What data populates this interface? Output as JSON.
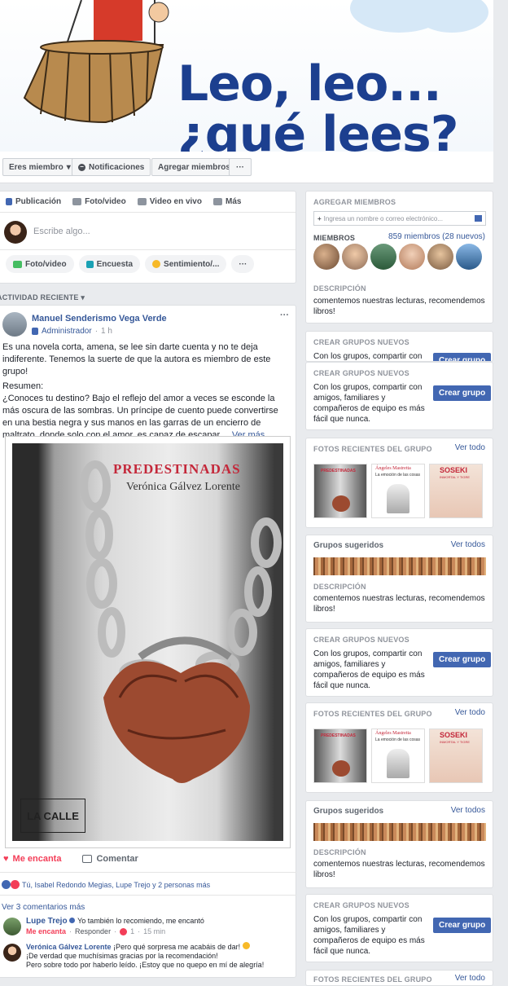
{
  "cover": {
    "title_line1": "Leo, leo...",
    "title_line2": "¿qué lees?"
  },
  "actions": {
    "member": "Eres miembro",
    "notifications": "Notificaciones",
    "add_members": "Agregar miembros",
    "more": "···"
  },
  "composer": {
    "tabs": [
      "Publicación",
      "Foto/video",
      "Video en vivo",
      "Más"
    ],
    "placeholder": "Escribe algo...",
    "pills": [
      "Foto/video",
      "Encuesta",
      "Sentimiento/...",
      "···"
    ]
  },
  "activity": {
    "label": "ACTIVIDAD RECIENTE"
  },
  "post": {
    "author": "Manuel Senderismo Vega Verde",
    "role": "Administrador",
    "time": "1 h",
    "menu": "···",
    "paragraph1": "Es una novela corta, amena, se lee sin darte cuenta y no te deja indiferente. Tenemos la suerte de que la autora es miembro de este grupo!",
    "paragraph2_label": "Resumen:",
    "paragraph2": "¿Conoces tu destino? Bajo el reflejo del amor a veces se esconde la más oscura de las sombras. Un príncipe de cuento puede convertirse en una bestia negra y sus manos en las garras de un encierro de maltrato, donde solo con el amor, es capaz de escapar....",
    "see_more": "Ver más",
    "book_title": "PREDESTINADAS",
    "book_author": "Verónica Gálvez Lorente",
    "publisher": "LA CALLE",
    "like": "Me encanta",
    "comment": "Comentar",
    "reactions": "Tú, Isabel Redondo Megias, Lupe Trejo y 2 personas más",
    "more_comments": "Ver 3 comentarios más"
  },
  "comments": [
    {
      "author": "Lupe Trejo",
      "text": "Yo también lo recomiendo, me encantó",
      "like": "Me encanta",
      "reply": "Responder",
      "count": "1",
      "time": "15 min"
    },
    {
      "author": "Verónica Gálvez Lorente",
      "text1": "¡Pero qué sorpresa me acabáis de dar!",
      "text2": "¡De verdad que muchísimas gracias por la recomendación!",
      "text3": "Pero sobre todo por haberlo leído. ¡Estoy que no quepo en mí de alegría!"
    }
  ],
  "sidebar": {
    "add_members_header": "AGREGAR MIEMBROS",
    "add_members_placeholder": "Ingresa un nombre o correo electrónico...",
    "members_header": "MIEMBROS",
    "members_count": "859 miembros (28 nuevos)",
    "description_header": "DESCRIPCIÓN",
    "description": "comentemos nuestras lecturas, recomendemos libros!",
    "create_groups_header": "CREAR GRUPOS NUEVOS",
    "create_groups_text": "Con los grupos, compartir con amigos, familiares y compañeros de equipo es más fácil que nunca.",
    "create_groups_partial": "Con los grupos, compartir con",
    "create_group_btn": "Crear grupo",
    "recent_photos_header": "FOTOS RECIENTES DEL GRUPO",
    "see_all": "Ver todo",
    "suggested_header": "Grupos sugeridos",
    "see_all_plural": "Ver todos",
    "thumb1_title": "PREDESTINADAS",
    "thumb2_author": "Ángeles Mastretta",
    "thumb2_title": "La emoción de las cosas",
    "thumb3_title": "SOSEKI",
    "thumb3_sub": "INMORTAL Y TIGRE"
  },
  "colors": {
    "brand": "#4267b2",
    "link": "#365899",
    "bg": "#e9ebee",
    "love": "#f33e58"
  }
}
